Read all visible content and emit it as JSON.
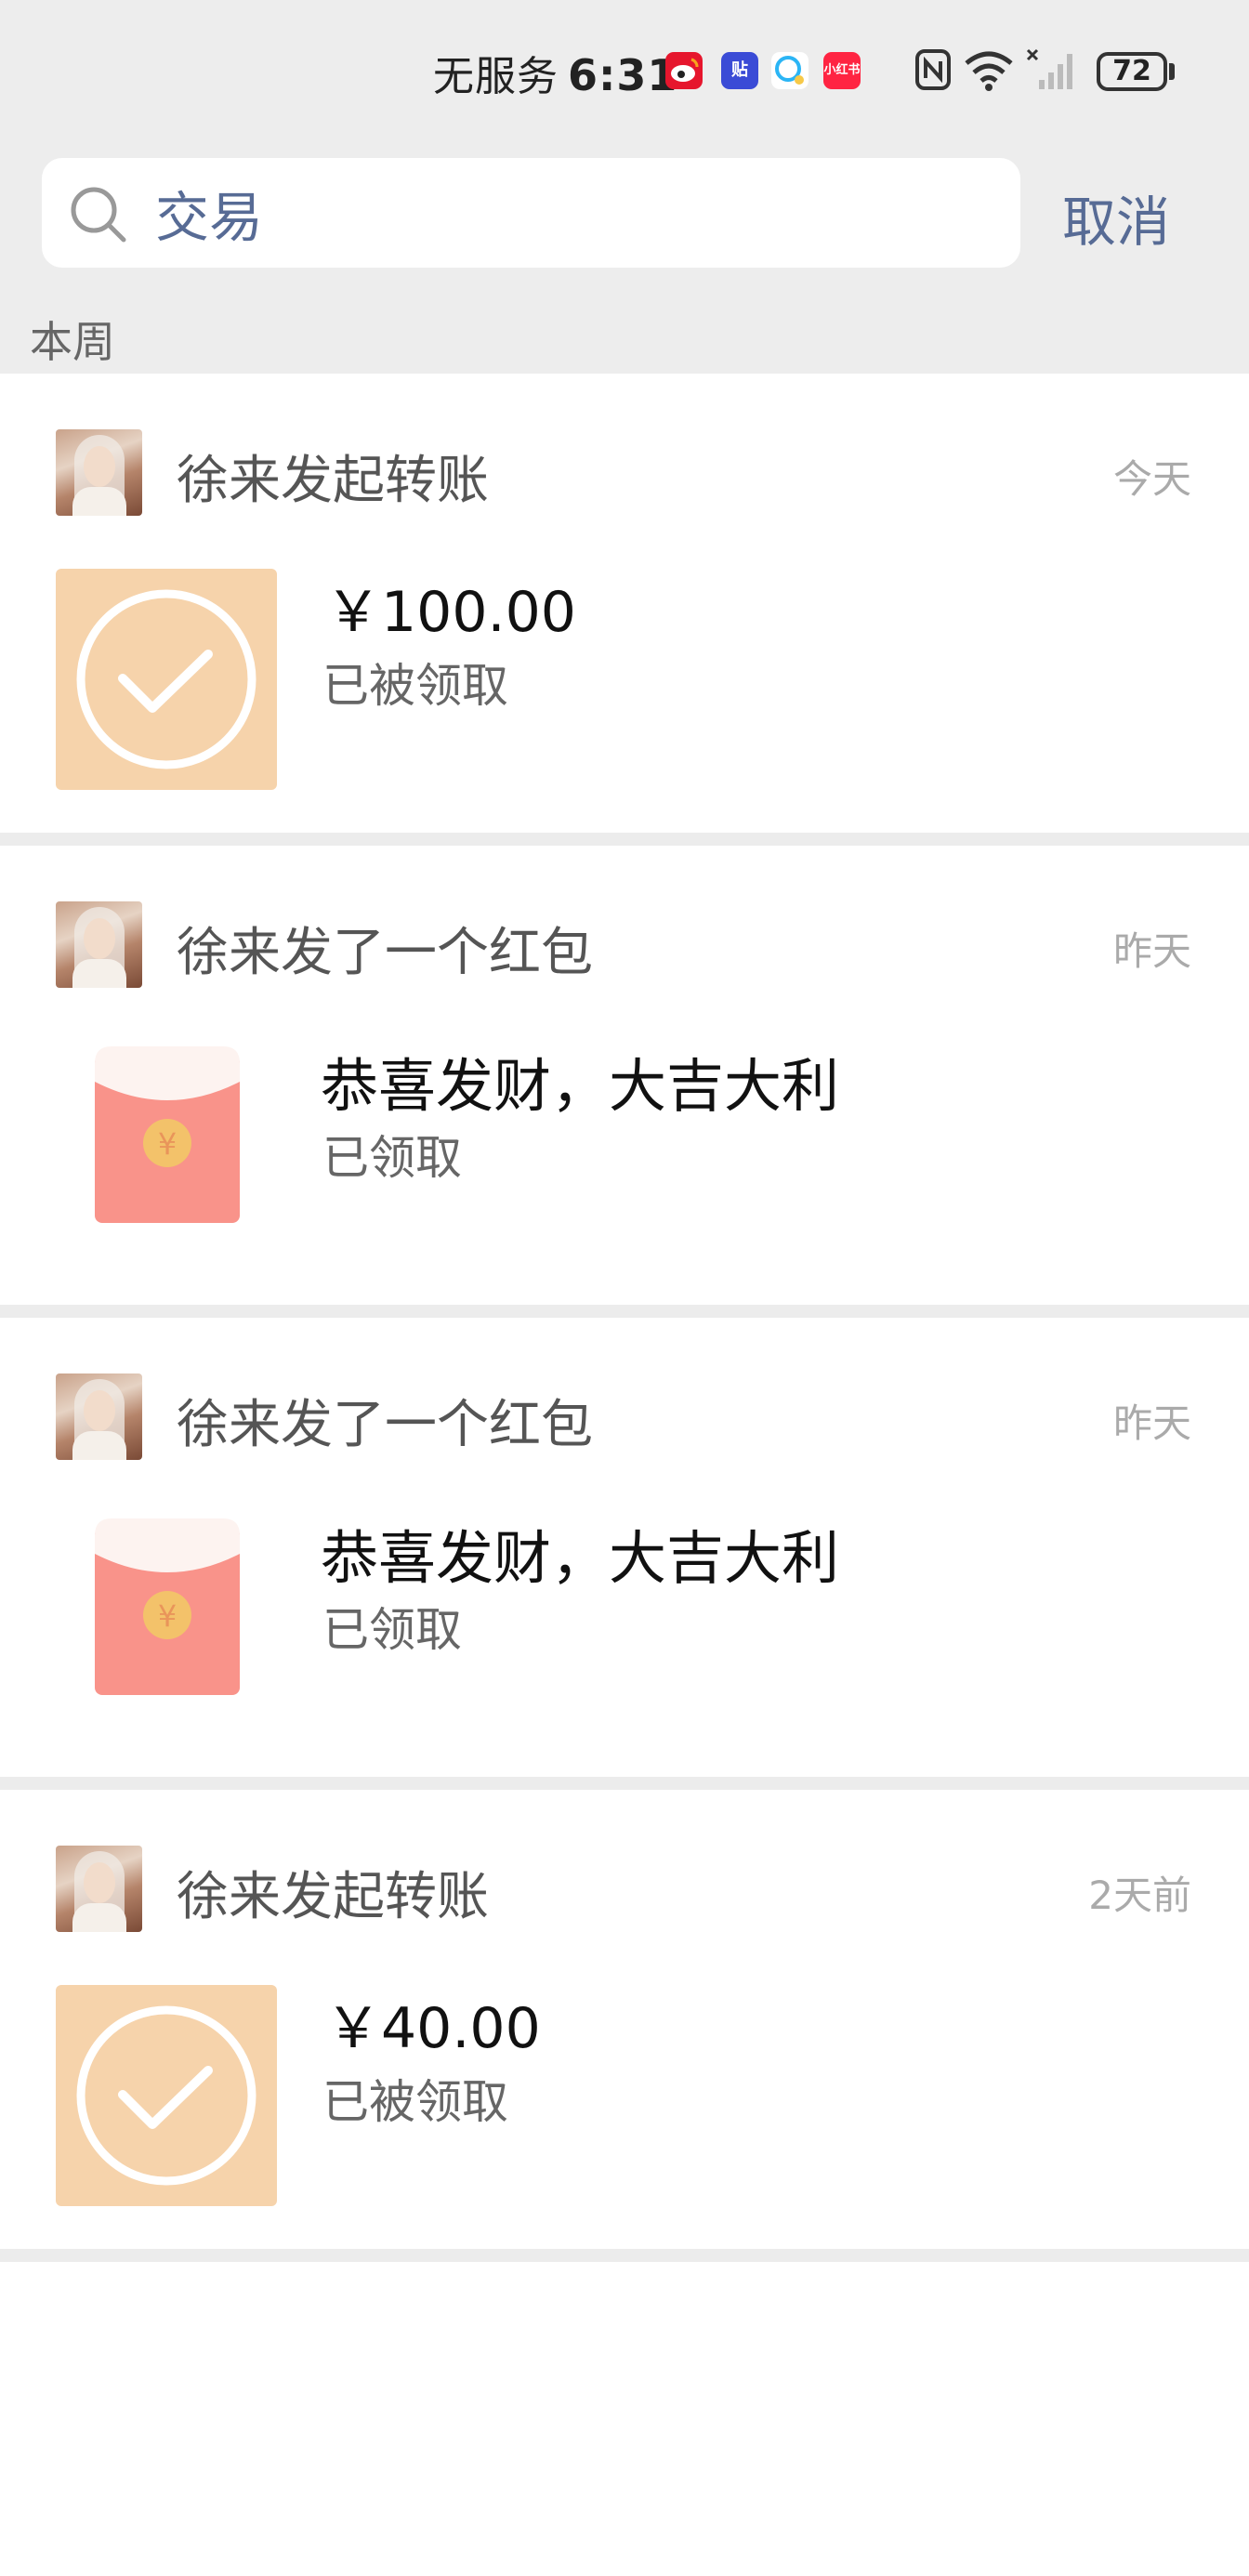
{
  "status_bar": {
    "carrier": "无服务",
    "time": "6:31",
    "apps": [
      {
        "icon": "weibo-icon",
        "color": "#e6162d"
      },
      {
        "icon": "tieba-icon",
        "color": "#3a4bd6"
      },
      {
        "icon": "qq-icon",
        "color": "#2bb5f5"
      },
      {
        "icon": "xiaohongshu-icon",
        "label": "小红书",
        "color": "#ff2442"
      }
    ],
    "battery": "72"
  },
  "search": {
    "query": "交易",
    "cancel_label": "取消"
  },
  "section_label": "本周",
  "items": [
    {
      "type": "transfer",
      "title": "徐来发起转账",
      "time": "今天",
      "main": "￥100.00",
      "status": "已被领取"
    },
    {
      "type": "redpacket",
      "title": "徐来发了一个红包",
      "time": "昨天",
      "main": "恭喜发财，大吉大利",
      "status": "已领取"
    },
    {
      "type": "redpacket",
      "title": "徐来发了一个红包",
      "time": "昨天",
      "main": "恭喜发财，大吉大利",
      "status": "已领取"
    },
    {
      "type": "transfer",
      "title": "徐来发起转账",
      "time": "2天前",
      "main": "￥40.00",
      "status": "已被领取"
    }
  ],
  "colors": {
    "link": "#576b95",
    "transfer_bg": "#f6d3ab",
    "redpacket": "#f9938a",
    "coin": "#f3c26a"
  }
}
